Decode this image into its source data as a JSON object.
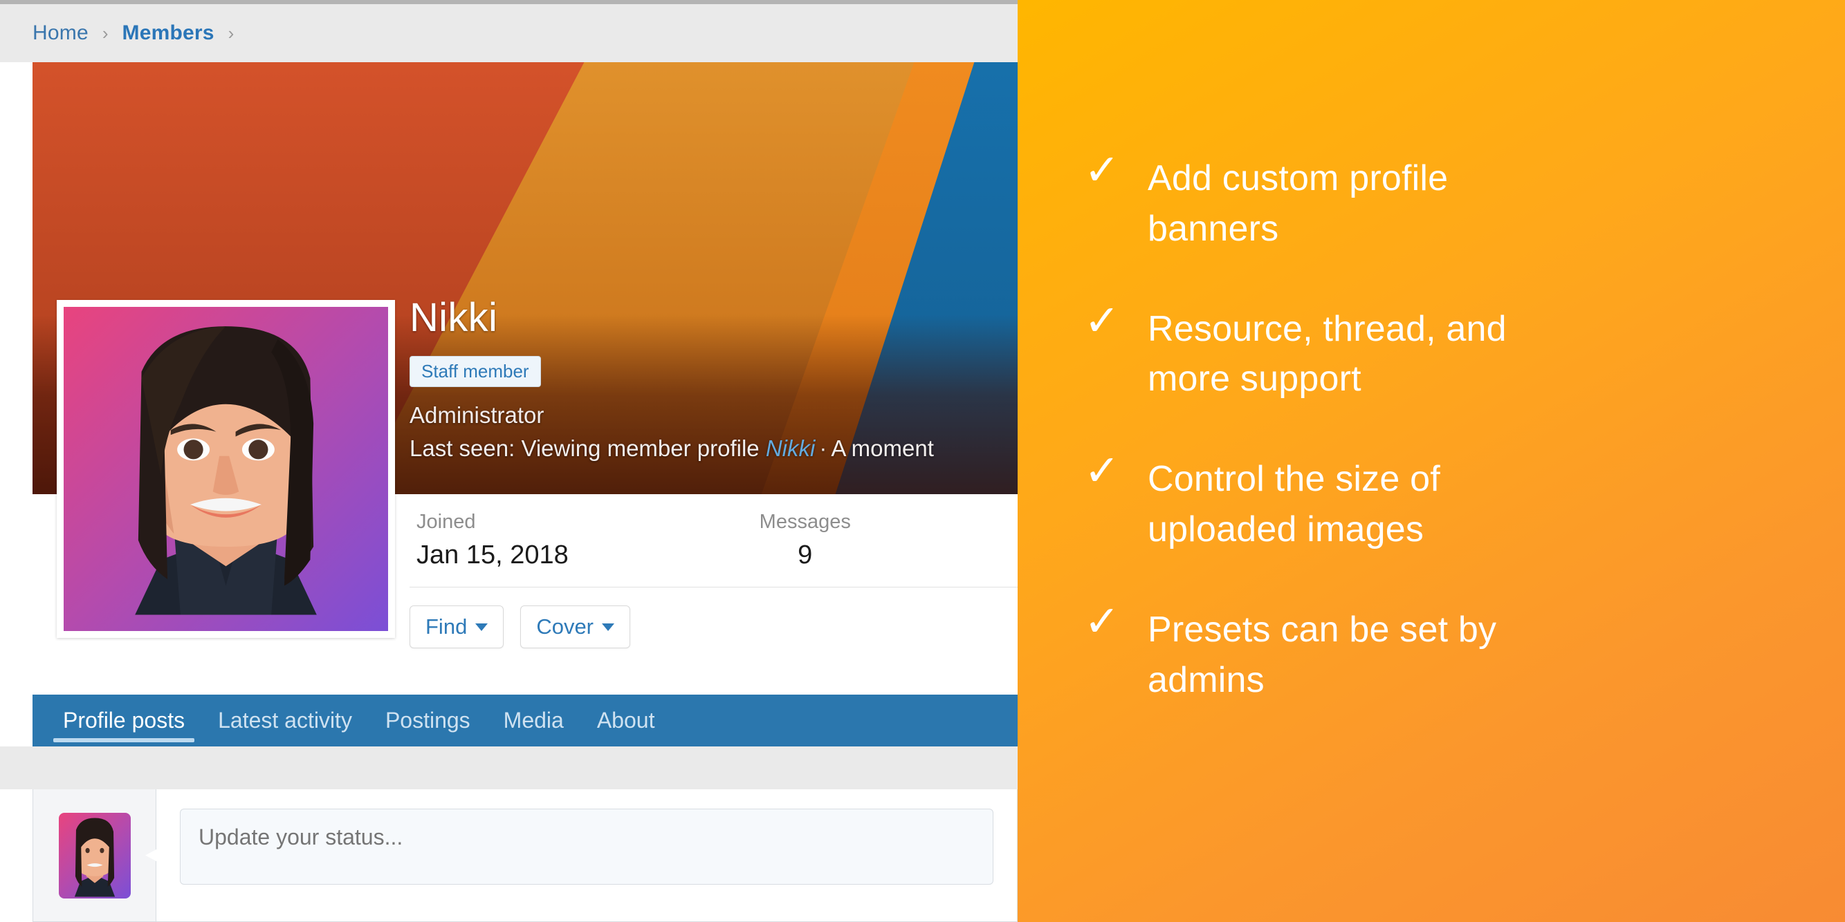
{
  "breadcrumb": {
    "items": [
      {
        "label": "Home",
        "current": false
      },
      {
        "label": "Members",
        "current": true
      }
    ],
    "separator": "›"
  },
  "profile": {
    "name": "Nikki",
    "badge": "Staff member",
    "user_title": "Administrator",
    "last_seen_prefix": "Last seen: Viewing member profile",
    "last_seen_link": "Nikki",
    "last_seen_dot": "·",
    "last_seen_time": "A moment",
    "stats": [
      {
        "label": "Joined",
        "value": "Jan 15, 2018"
      },
      {
        "label": "Messages",
        "value": "9"
      }
    ],
    "actions": [
      {
        "label": "Find",
        "icon": "chevron-down-icon"
      },
      {
        "label": "Cover",
        "icon": "chevron-down-icon"
      }
    ]
  },
  "tabs": [
    {
      "label": "Profile posts",
      "active": true
    },
    {
      "label": "Latest activity",
      "active": false
    },
    {
      "label": "Postings",
      "active": false
    },
    {
      "label": "Media",
      "active": false
    },
    {
      "label": "About",
      "active": false
    }
  ],
  "composer": {
    "placeholder": "Update your status...",
    "value": ""
  },
  "promo": {
    "check_glyph": "✓",
    "items": [
      {
        "text": "Add custom profile banners"
      },
      {
        "text": "Resource, thread, and more support"
      },
      {
        "text": "Control the size of uploaded images"
      },
      {
        "text": "Presets can be set by admins"
      }
    ]
  },
  "colors": {
    "accent_blue": "#2e7ab8",
    "tab_bar_blue": "#2b77ae",
    "promo_orange_start": "#ffb600",
    "promo_orange_end": "#f88b33",
    "breadcrumb_bg": "#eaeaea"
  }
}
